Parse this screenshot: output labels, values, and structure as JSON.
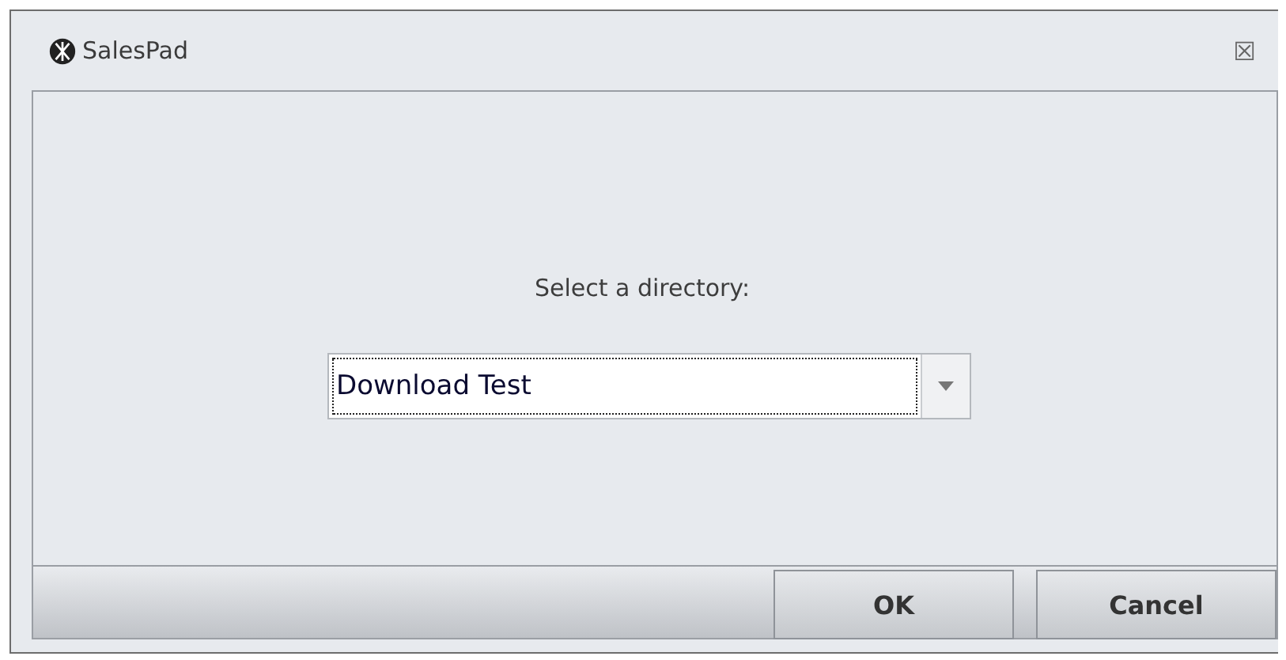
{
  "window": {
    "title": "SalesPad",
    "close": "☒"
  },
  "prompt": "Select a directory:",
  "directory": {
    "value": "Download Test"
  },
  "buttons": [
    {
      "label": "OK"
    },
    {
      "label": "Cancel"
    }
  ]
}
